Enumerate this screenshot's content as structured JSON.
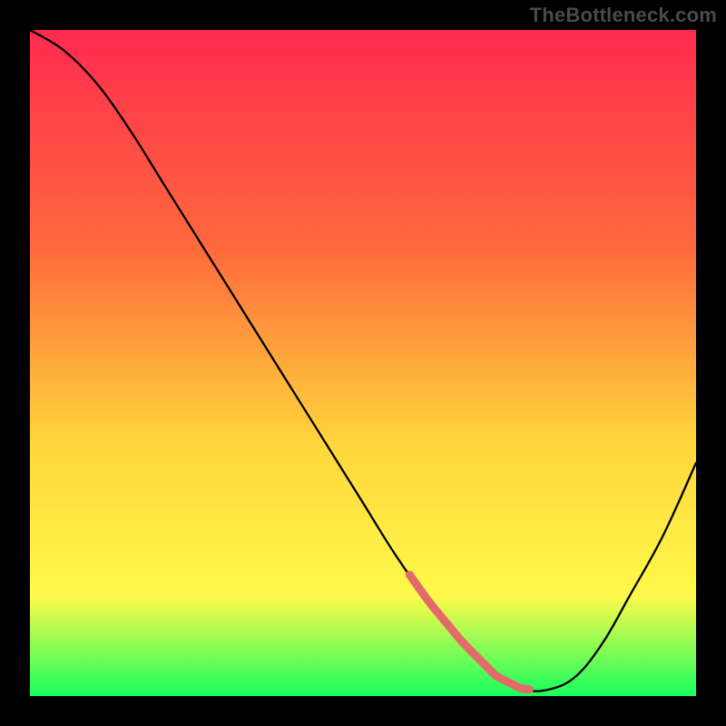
{
  "watermark": "TheBottleneck.com",
  "colors": {
    "background": "#000000",
    "gradient_top": "#ff2b4f",
    "gradient_mid1": "#ff6a3c",
    "gradient_mid2": "#ffd63b",
    "gradient_mid3": "#fff94a",
    "gradient_bottom": "#18ff5e",
    "curve": "#000000",
    "highlight": "#e46a6a"
  },
  "chart_data": {
    "type": "line",
    "title": "",
    "xlabel": "",
    "ylabel": "",
    "xlim": [
      0,
      100
    ],
    "ylim": [
      0,
      100
    ],
    "series": [
      {
        "name": "bottleneck-curve",
        "x": [
          0,
          5,
          10,
          15,
          20,
          25,
          30,
          35,
          40,
          45,
          50,
          55,
          60,
          65,
          70,
          74,
          78,
          82,
          86,
          90,
          95,
          100
        ],
        "values": [
          100,
          97,
          92,
          85,
          77,
          69,
          61,
          53,
          45,
          37,
          29,
          21,
          14,
          8,
          3,
          1,
          1,
          3,
          8,
          15,
          24,
          35
        ]
      }
    ],
    "highlight_range_x": [
      57,
      75
    ],
    "annotations": []
  }
}
